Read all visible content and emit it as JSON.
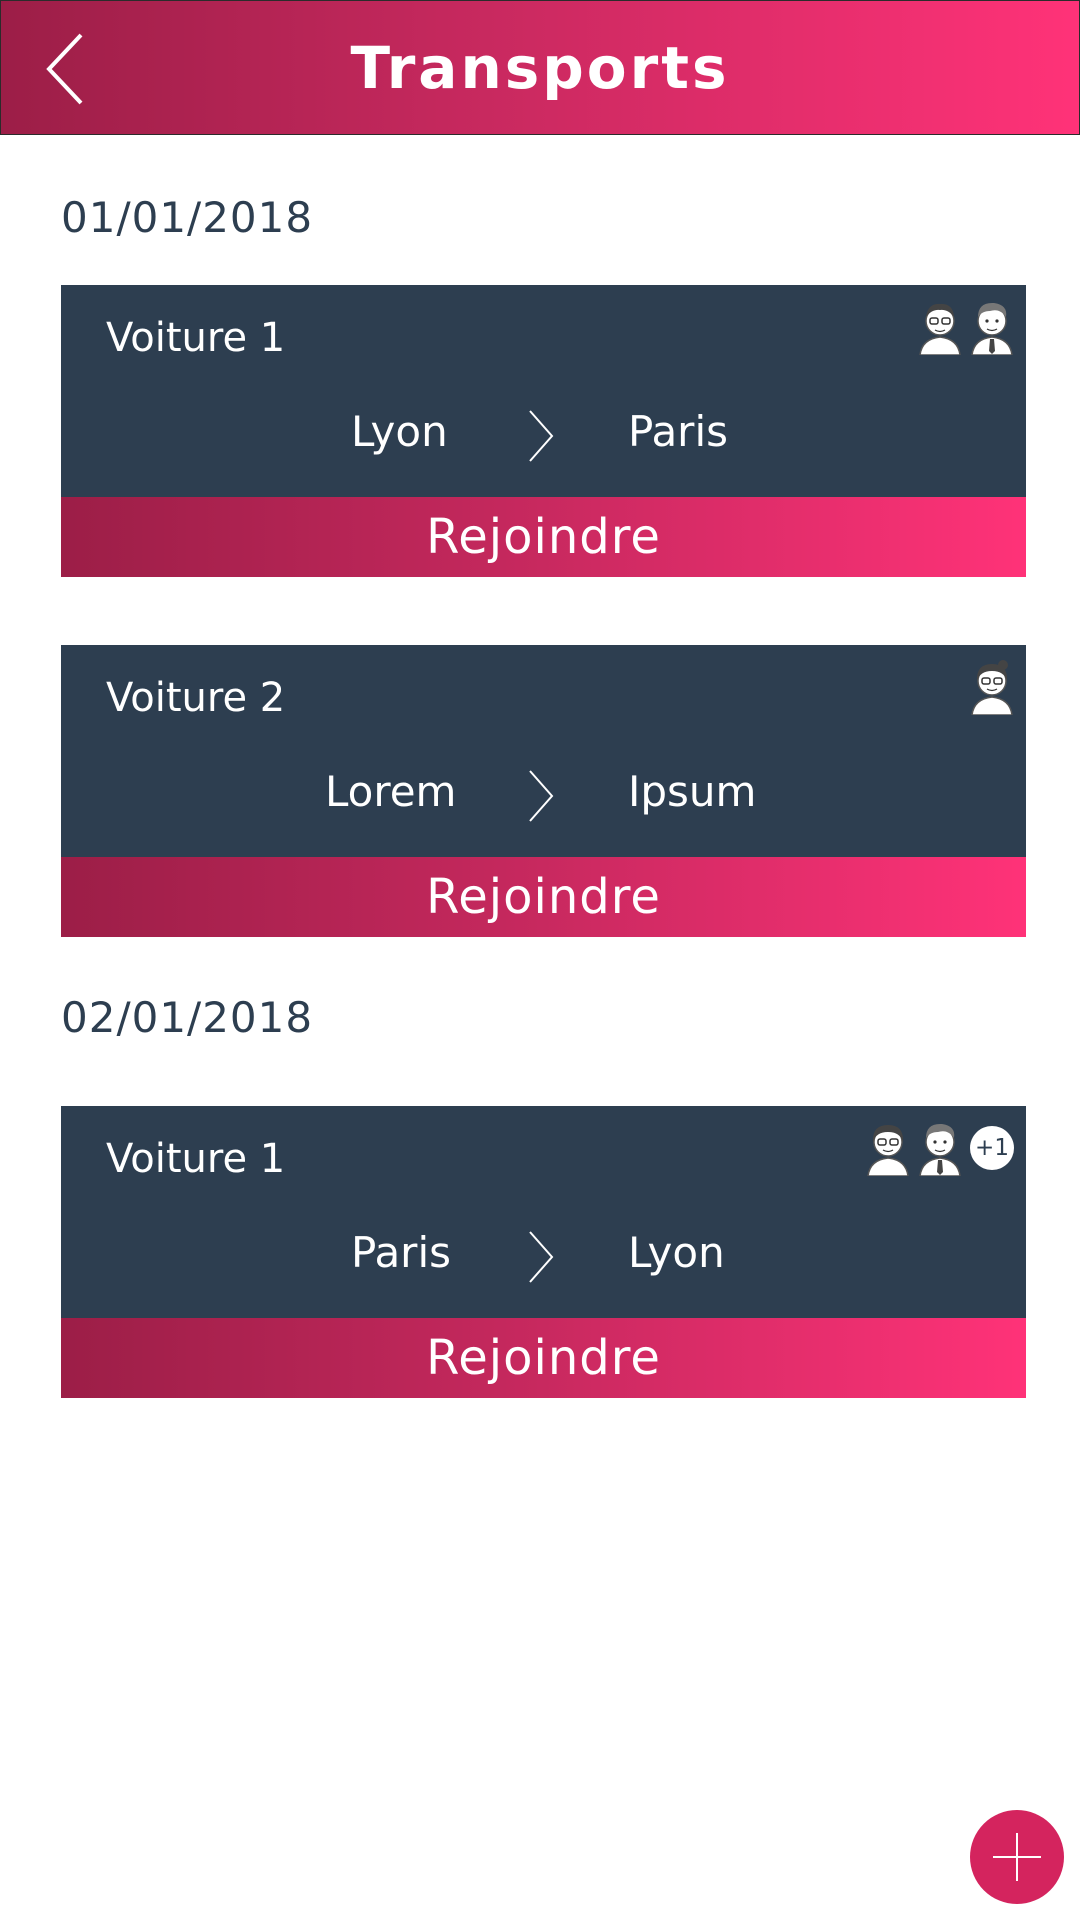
{
  "header": {
    "title": "Transports",
    "back_icon": "chevron-left-icon"
  },
  "colors": {
    "header_start": "#9c1e47",
    "header_end": "#ff3278",
    "card_bg": "#2d3e50",
    "fab": "#d4245e",
    "text_dark": "#2d3e50"
  },
  "groups": [
    {
      "date": "01/01/2018",
      "trips": [
        {
          "car": "Voiture 1",
          "from": "Lyon",
          "to": "Paris",
          "join_label": "Rejoindre",
          "passengers": [
            "avatar-man-glasses",
            "avatar-man-tie"
          ],
          "extra": ""
        },
        {
          "car": "Voiture 2",
          "from": "Lorem",
          "to": "Ipsum",
          "join_label": "Rejoindre",
          "passengers": [
            "avatar-woman-glasses"
          ],
          "extra": ""
        }
      ]
    },
    {
      "date": "02/01/2018",
      "trips": [
        {
          "car": "Voiture 1",
          "from": "Paris",
          "to": "Lyon",
          "join_label": "Rejoindre",
          "passengers": [
            "avatar-woman-glasses",
            "avatar-man-tie"
          ],
          "extra": "+1"
        }
      ]
    }
  ],
  "fab": {
    "icon": "plus-icon"
  }
}
